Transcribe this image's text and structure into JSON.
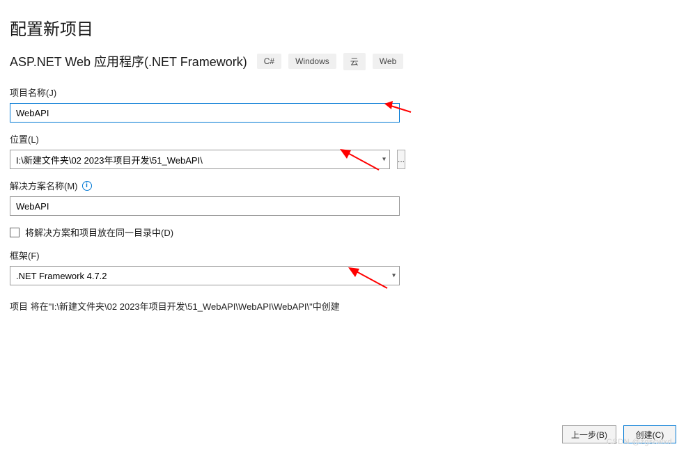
{
  "title": "配置新项目",
  "subtitle": "ASP.NET Web 应用程序(.NET Framework)",
  "tags": [
    "C#",
    "Windows",
    "云",
    "Web"
  ],
  "projectName": {
    "label": "项目名称(J)",
    "value": "WebAPI"
  },
  "location": {
    "label": "位置(L)",
    "value": "I:\\新建文件夹\\02 2023年项目开发\\51_WebAPI\\",
    "browse": "..."
  },
  "solutionName": {
    "label": "解决方案名称(M)",
    "value": "WebAPI"
  },
  "sameDirectory": {
    "label": "将解决方案和项目放在同一目录中(D)",
    "checked": false
  },
  "framework": {
    "label": "框架(F)",
    "value": ".NET Framework 4.7.2"
  },
  "summary": "项目 将在\"I:\\新建文件夹\\02 2023年项目开发\\51_WebAPI\\WebAPI\\WebAPI\\\"中创建",
  "footer": {
    "back": "上一步(B)",
    "create": "创建(C)"
  },
  "watermark": "CSDN @zgscwxd"
}
